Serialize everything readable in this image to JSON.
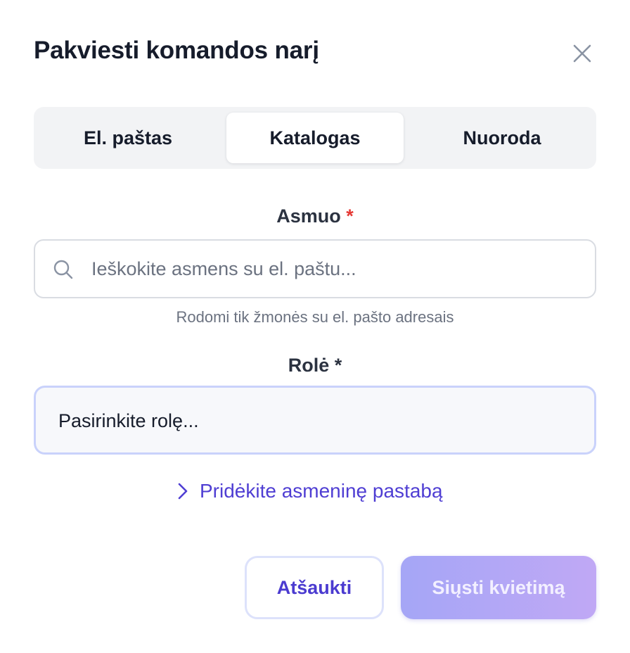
{
  "dialog": {
    "title": "Pakviesti komandos narį"
  },
  "tabs": [
    {
      "label": "El. paštas",
      "active": false
    },
    {
      "label": "Katalogas",
      "active": true
    },
    {
      "label": "Nuoroda",
      "active": false
    }
  ],
  "person_field": {
    "label": "Asmuo",
    "required_mark": "*",
    "placeholder": "Ieškokite asmens su el. paštu...",
    "value": "",
    "hint": "Rodomi tik žmonės su el. pašto adresais"
  },
  "role_field": {
    "label": "Rolė",
    "required_mark": "*",
    "selected_text": "Pasirinkite rolę..."
  },
  "note_toggle": {
    "label": "Pridėkite asmeninę pastabą"
  },
  "actions": {
    "cancel_label": "Atšaukti",
    "send_label": "Siųsti kvietimą"
  },
  "colors": {
    "accent": "#4f3ed3",
    "required": "#e53935",
    "send_gradient_start": "#a5a6f6",
    "send_gradient_end": "#c0a8f5"
  },
  "icons": {
    "close": "close-icon",
    "search": "search-icon",
    "chevron": "chevron-right-icon"
  }
}
